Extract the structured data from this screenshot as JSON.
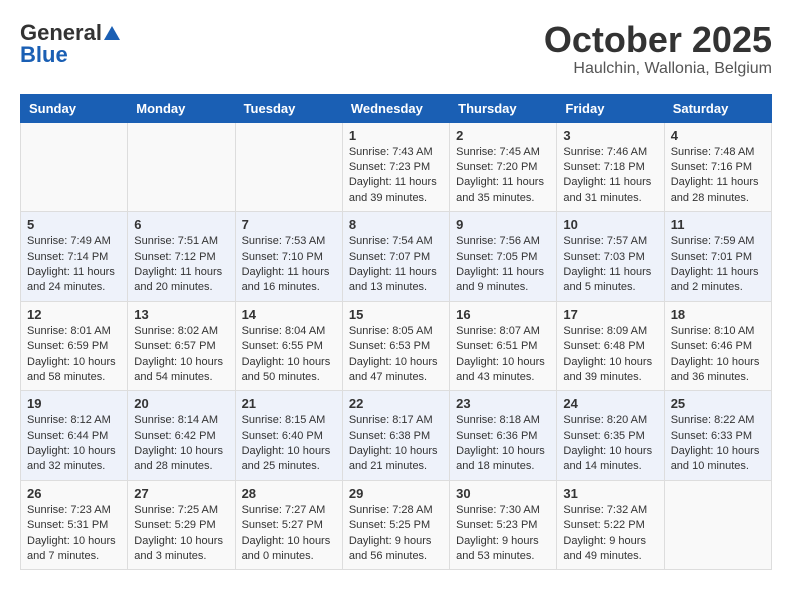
{
  "header": {
    "logo_general": "General",
    "logo_blue": "Blue",
    "month": "October 2025",
    "location": "Haulchin, Wallonia, Belgium"
  },
  "days_of_week": [
    "Sunday",
    "Monday",
    "Tuesday",
    "Wednesday",
    "Thursday",
    "Friday",
    "Saturday"
  ],
  "weeks": [
    [
      {
        "day": "",
        "info": ""
      },
      {
        "day": "",
        "info": ""
      },
      {
        "day": "",
        "info": ""
      },
      {
        "day": "1",
        "info": "Sunrise: 7:43 AM\nSunset: 7:23 PM\nDaylight: 11 hours and 39 minutes."
      },
      {
        "day": "2",
        "info": "Sunrise: 7:45 AM\nSunset: 7:20 PM\nDaylight: 11 hours and 35 minutes."
      },
      {
        "day": "3",
        "info": "Sunrise: 7:46 AM\nSunset: 7:18 PM\nDaylight: 11 hours and 31 minutes."
      },
      {
        "day": "4",
        "info": "Sunrise: 7:48 AM\nSunset: 7:16 PM\nDaylight: 11 hours and 28 minutes."
      }
    ],
    [
      {
        "day": "5",
        "info": "Sunrise: 7:49 AM\nSunset: 7:14 PM\nDaylight: 11 hours and 24 minutes."
      },
      {
        "day": "6",
        "info": "Sunrise: 7:51 AM\nSunset: 7:12 PM\nDaylight: 11 hours and 20 minutes."
      },
      {
        "day": "7",
        "info": "Sunrise: 7:53 AM\nSunset: 7:10 PM\nDaylight: 11 hours and 16 minutes."
      },
      {
        "day": "8",
        "info": "Sunrise: 7:54 AM\nSunset: 7:07 PM\nDaylight: 11 hours and 13 minutes."
      },
      {
        "day": "9",
        "info": "Sunrise: 7:56 AM\nSunset: 7:05 PM\nDaylight: 11 hours and 9 minutes."
      },
      {
        "day": "10",
        "info": "Sunrise: 7:57 AM\nSunset: 7:03 PM\nDaylight: 11 hours and 5 minutes."
      },
      {
        "day": "11",
        "info": "Sunrise: 7:59 AM\nSunset: 7:01 PM\nDaylight: 11 hours and 2 minutes."
      }
    ],
    [
      {
        "day": "12",
        "info": "Sunrise: 8:01 AM\nSunset: 6:59 PM\nDaylight: 10 hours and 58 minutes."
      },
      {
        "day": "13",
        "info": "Sunrise: 8:02 AM\nSunset: 6:57 PM\nDaylight: 10 hours and 54 minutes."
      },
      {
        "day": "14",
        "info": "Sunrise: 8:04 AM\nSunset: 6:55 PM\nDaylight: 10 hours and 50 minutes."
      },
      {
        "day": "15",
        "info": "Sunrise: 8:05 AM\nSunset: 6:53 PM\nDaylight: 10 hours and 47 minutes."
      },
      {
        "day": "16",
        "info": "Sunrise: 8:07 AM\nSunset: 6:51 PM\nDaylight: 10 hours and 43 minutes."
      },
      {
        "day": "17",
        "info": "Sunrise: 8:09 AM\nSunset: 6:48 PM\nDaylight: 10 hours and 39 minutes."
      },
      {
        "day": "18",
        "info": "Sunrise: 8:10 AM\nSunset: 6:46 PM\nDaylight: 10 hours and 36 minutes."
      }
    ],
    [
      {
        "day": "19",
        "info": "Sunrise: 8:12 AM\nSunset: 6:44 PM\nDaylight: 10 hours and 32 minutes."
      },
      {
        "day": "20",
        "info": "Sunrise: 8:14 AM\nSunset: 6:42 PM\nDaylight: 10 hours and 28 minutes."
      },
      {
        "day": "21",
        "info": "Sunrise: 8:15 AM\nSunset: 6:40 PM\nDaylight: 10 hours and 25 minutes."
      },
      {
        "day": "22",
        "info": "Sunrise: 8:17 AM\nSunset: 6:38 PM\nDaylight: 10 hours and 21 minutes."
      },
      {
        "day": "23",
        "info": "Sunrise: 8:18 AM\nSunset: 6:36 PM\nDaylight: 10 hours and 18 minutes."
      },
      {
        "day": "24",
        "info": "Sunrise: 8:20 AM\nSunset: 6:35 PM\nDaylight: 10 hours and 14 minutes."
      },
      {
        "day": "25",
        "info": "Sunrise: 8:22 AM\nSunset: 6:33 PM\nDaylight: 10 hours and 10 minutes."
      }
    ],
    [
      {
        "day": "26",
        "info": "Sunrise: 7:23 AM\nSunset: 5:31 PM\nDaylight: 10 hours and 7 minutes."
      },
      {
        "day": "27",
        "info": "Sunrise: 7:25 AM\nSunset: 5:29 PM\nDaylight: 10 hours and 3 minutes."
      },
      {
        "day": "28",
        "info": "Sunrise: 7:27 AM\nSunset: 5:27 PM\nDaylight: 10 hours and 0 minutes."
      },
      {
        "day": "29",
        "info": "Sunrise: 7:28 AM\nSunset: 5:25 PM\nDaylight: 9 hours and 56 minutes."
      },
      {
        "day": "30",
        "info": "Sunrise: 7:30 AM\nSunset: 5:23 PM\nDaylight: 9 hours and 53 minutes."
      },
      {
        "day": "31",
        "info": "Sunrise: 7:32 AM\nSunset: 5:22 PM\nDaylight: 9 hours and 49 minutes."
      },
      {
        "day": "",
        "info": ""
      }
    ]
  ]
}
